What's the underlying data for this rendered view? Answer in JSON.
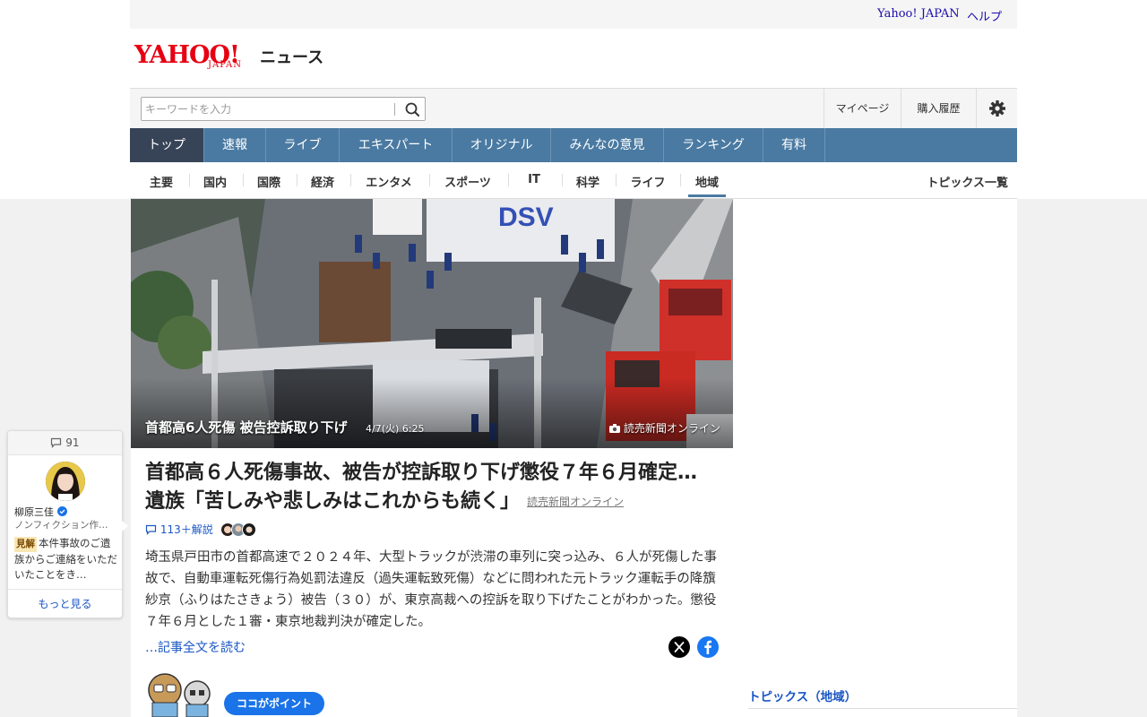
{
  "topbar": {
    "yahoo_japan": "Yahoo! JAPAN",
    "help": "ヘルプ"
  },
  "logo": {
    "yahoo": "YAHOO!",
    "japan": "JAPAN",
    "news": "ニュース"
  },
  "search": {
    "placeholder": "キーワードを入力"
  },
  "utility": {
    "mypage": "マイページ",
    "purchase_history": "購入履歴"
  },
  "mainnav": [
    "トップ",
    "速報",
    "ライブ",
    "エキスパート",
    "オリジナル",
    "みんなの意見",
    "ランキング",
    "有料"
  ],
  "subnav": [
    "主要",
    "国内",
    "国際",
    "経済",
    "エンタメ",
    "スポーツ",
    "IT",
    "科学",
    "ライフ",
    "地域"
  ],
  "subnav_active": "地域",
  "topics_list": "トピックス一覧",
  "hero": {
    "caption": "首都高6人死傷 被告控訴取り下げ",
    "date": "4/7(火) 6:25",
    "source": "読売新聞オンライン"
  },
  "article": {
    "headline": "首都高６人死傷事故、被告が控訴取り下げ懲役７年６月確定…遺族「苦しみや悲しみはこれからも続く」",
    "source": "読売新聞オンライン",
    "comments": "113＋解説",
    "lead": "埼玉県戸田市の首都高速で２０２４年、大型トラックが渋滞の車列に突っ込み、６人が死傷した事故で、自動車運転死傷行為処罰法違反（過失運転致死傷）などに問われた元トラック運転手の降籏紗京（ふりはたさきょう）被告（３０）が、東京高裁への控訴を取り下げたことがわかった。懲役７年６月とした１審・東京地裁判決が確定した。",
    "read_more": "…記事全文を読む",
    "point": "ココがポイント"
  },
  "expert": {
    "count": "91",
    "name": "柳原三佳",
    "title": "ノンフィクション作…",
    "badge": "見解",
    "text": "本件事故のご遺族からご連絡をいただいたことをき…",
    "more": "もっと見る"
  },
  "right": {
    "topics_title": "トピックス（地域）"
  },
  "colors": {
    "nav": "#4a7aa2",
    "nav_active": "#374458",
    "link": "#1a56c4",
    "brand": "#e60012"
  }
}
